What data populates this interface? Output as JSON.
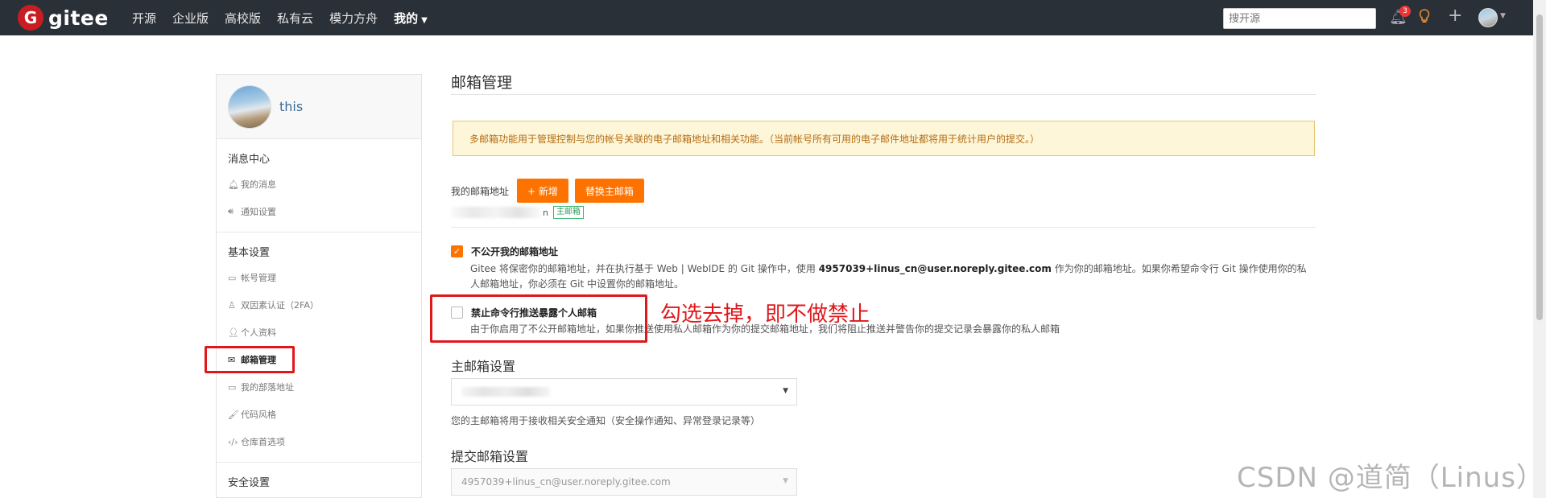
{
  "nav": {
    "logo_letter": "G",
    "logo_text": "gitee",
    "links": [
      "开源",
      "企业版",
      "高校版",
      "私有云",
      "模力方舟",
      "我的"
    ],
    "search_placeholder": "搜开源",
    "notification_count": "3"
  },
  "sidebar": {
    "username": "this",
    "sections": [
      {
        "title": "消息中心",
        "items": [
          {
            "icon": "bell-icon",
            "label": "我的消息"
          },
          {
            "icon": "speaker-icon",
            "label": "通知设置"
          }
        ]
      },
      {
        "title": "基本设置",
        "items": [
          {
            "icon": "id-card-icon",
            "label": "帐号管理"
          },
          {
            "icon": "user-key-icon",
            "label": "双因素认证（2FA）"
          },
          {
            "icon": "person-icon",
            "label": "个人资料"
          },
          {
            "icon": "envelope-icon",
            "label": "邮箱管理",
            "active": true
          },
          {
            "icon": "id-card-icon",
            "label": "我的部落地址"
          },
          {
            "icon": "brush-icon",
            "label": "代码风格"
          },
          {
            "icon": "code-icon",
            "label": "仓库首选项"
          }
        ]
      },
      {
        "title": "安全设置",
        "items": []
      }
    ]
  },
  "main": {
    "title": "邮箱管理",
    "notice": "多邮箱功能用于管理控制与您的帐号关联的电子邮箱地址和相关功能。（当前帐号所有可用的电子邮件地址都将用于统计用户的提交。）",
    "my_email_label": "我的邮箱地址",
    "add_button": "+ 新增",
    "replace_button": "替换主邮箱",
    "email_suffix": "n",
    "primary_tag": "主邮箱",
    "hide_email": {
      "checked": true,
      "title": "不公开我的邮箱地址",
      "desc_1": "Gitee 将保密你的邮箱地址，并在执行基于 Web | WebIDE 的 Git 操作中，使用 ",
      "noreply": "4957039+linus_cn@user.noreply.gitee.com",
      "desc_2": " 作为你的邮箱地址。如果你希望命令行 Git 操作使用你的私人邮箱地址，你必须在 Git 中设置你的邮箱地址。"
    },
    "block_push": {
      "checked": false,
      "title": "禁止命令行推送暴露个人邮箱",
      "desc": "由于你启用了不公开邮箱地址，如果你推送使用私人邮箱作为你的提交邮箱地址，我们将阻止推送并警告你的提交记录会暴露你的私人邮箱"
    },
    "annotation": "勾选去掉，即不做禁止",
    "primary_settings_title": "主邮箱设置",
    "primary_hint": "您的主邮箱将用于接收相关安全通知（安全操作通知、异常登录记录等）",
    "commit_settings_title": "提交邮箱设置",
    "commit_email": "4957039+linus_cn@user.noreply.gitee.com"
  },
  "watermark": "CSDN @道简（Linus）",
  "colors": {
    "nav_bg": "#2a3038",
    "brand_red": "#c71d23",
    "accent_orange": "#fe7300",
    "annotation_red": "#e0181c"
  }
}
